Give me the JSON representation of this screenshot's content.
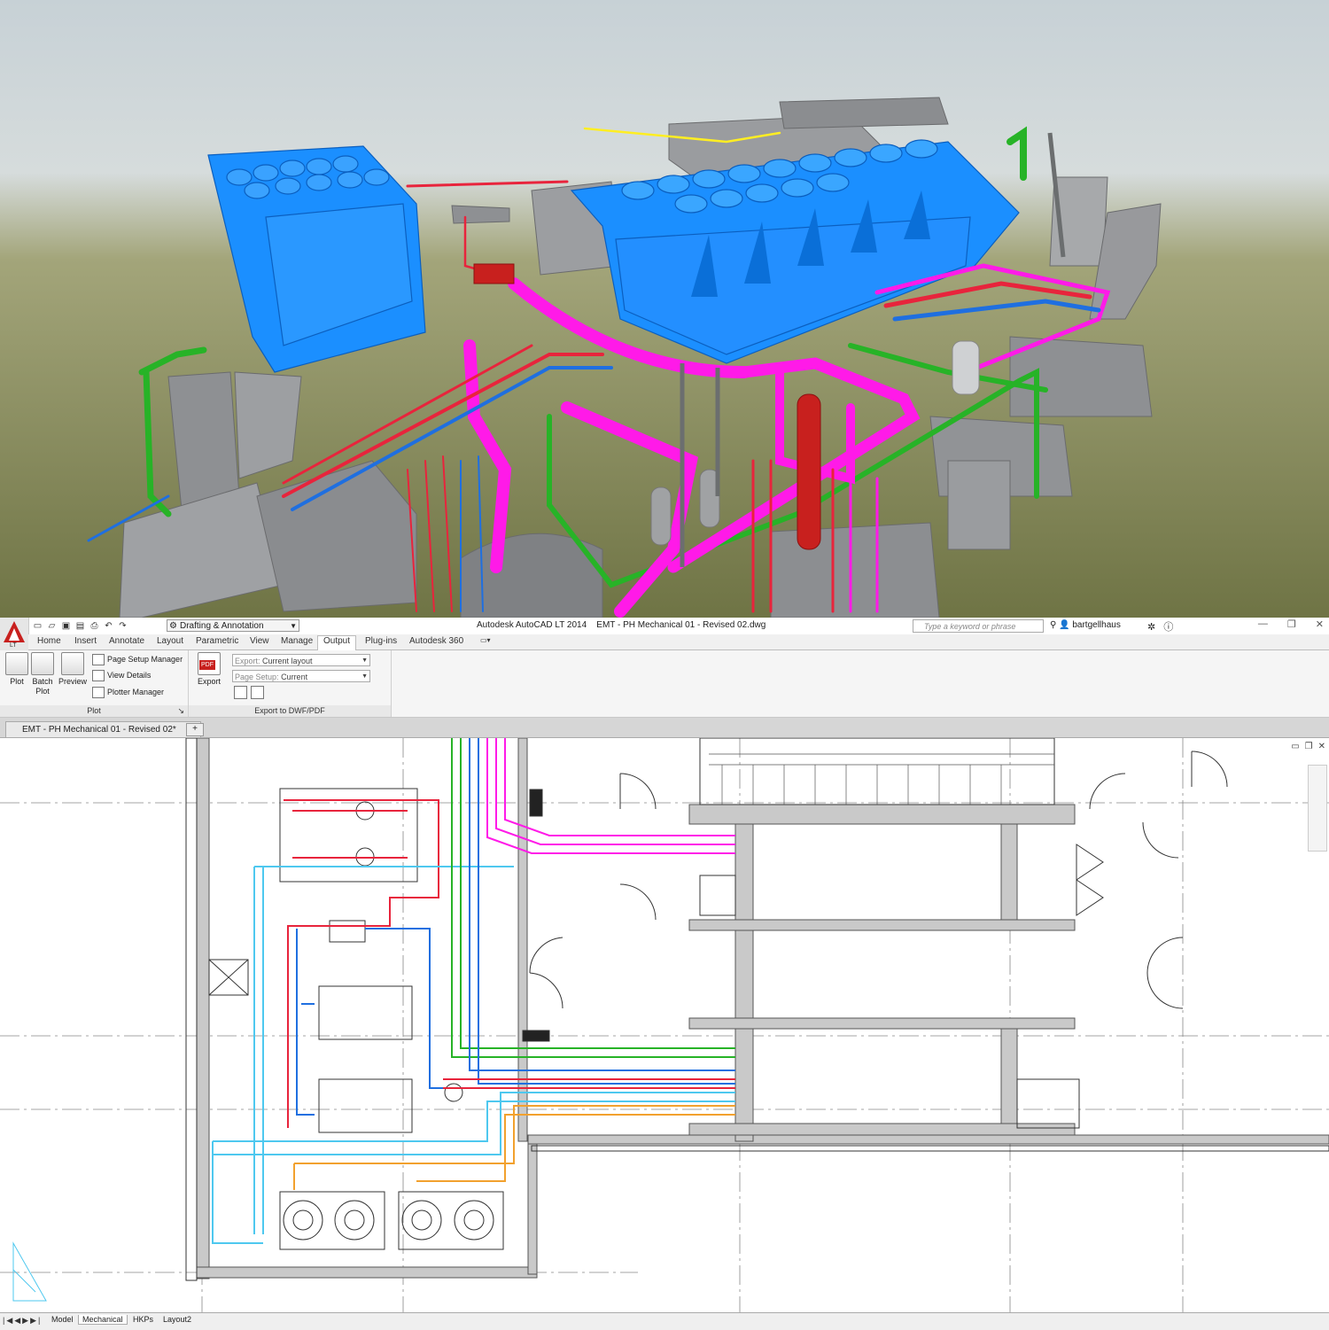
{
  "titlebar": {
    "workspace": "Drafting & Annotation",
    "app_title": "Autodesk AutoCAD LT 2014",
    "file_title": "EMT - PH Mechanical 01 - Revised 02.dwg",
    "search_placeholder": "Type a keyword or phrase",
    "username": "bartgellhaus",
    "app_badge": "LT"
  },
  "ribbon_tabs": [
    "Home",
    "Insert",
    "Annotate",
    "Layout",
    "Parametric",
    "View",
    "Manage",
    "Output",
    "Plug-ins",
    "Autodesk 360"
  ],
  "active_tab": "Output",
  "ribbon": {
    "plot_panel": {
      "title": "Plot",
      "plot": "Plot",
      "batch_plot_1": "Batch",
      "batch_plot_2": "Plot",
      "preview": "Preview",
      "page_setup_manager": "Page Setup Manager",
      "view_details": "View Details",
      "plotter_manager": "Plotter Manager"
    },
    "export_panel": {
      "title": "Export to DWF/PDF",
      "export": "Export",
      "pdf_badge": "PDF",
      "export_label": "Export:",
      "export_value": "Current layout",
      "page_setup_label": "Page Setup:",
      "page_setup_value": "Current"
    }
  },
  "document_tab": "EMT - PH Mechanical 01 - Revised 02*",
  "layout_tabs": [
    "Model",
    "Mechanical",
    "HKPs",
    "Layout2"
  ],
  "active_layout": "Mechanical",
  "colors": {
    "accent_red": "#c8201e",
    "pipe_red": "#e8243c",
    "pipe_blue": "#1f6fe0",
    "pipe_magenta": "#ff1ae8",
    "pipe_green": "#27b327",
    "pipe_cyan": "#4ec8ef",
    "pipe_orange": "#f2a12e",
    "equipment_blue": "#1b8fff",
    "sky": "#c9d3d6",
    "ground": "#7d8052"
  }
}
